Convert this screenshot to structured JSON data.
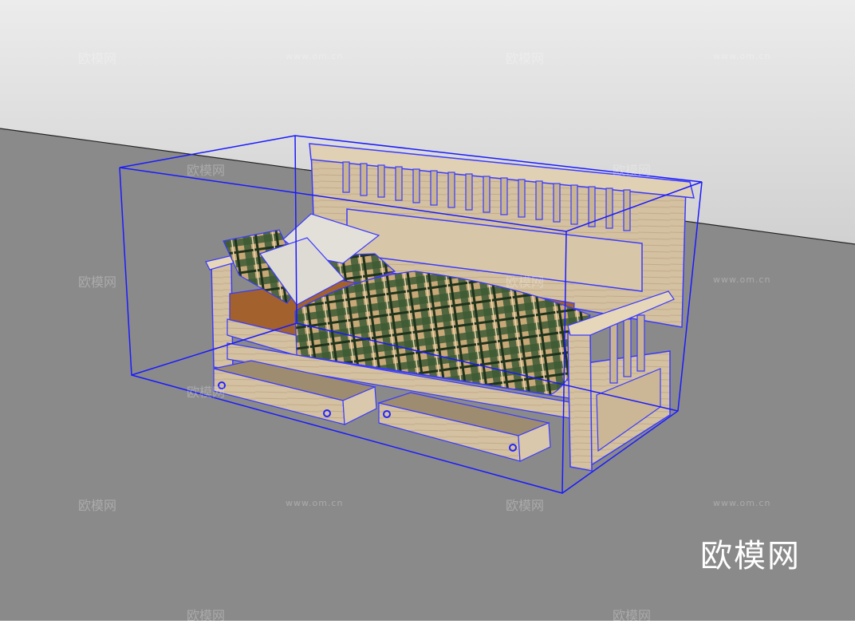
{
  "watermark": {
    "brand": "欧模网",
    "url": "www.om.cn"
  },
  "logo": {
    "text": "欧模网"
  },
  "colors": {
    "selection_box": "#1a1aff",
    "wood": "#d3bf9f",
    "blanket_green": "#2f4a2a",
    "blanket_tan": "#c9a877",
    "ground": "#898989"
  }
}
